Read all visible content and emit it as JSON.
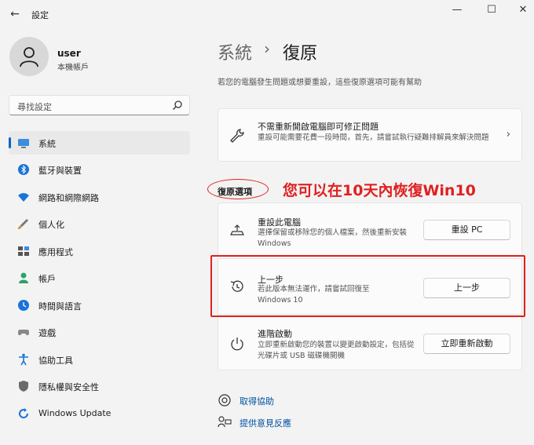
{
  "window": {
    "title": "設定",
    "back_glyph": "←",
    "minimize_glyph": "—",
    "maximize_glyph": "☐",
    "close_glyph": "✕"
  },
  "user": {
    "name": "user",
    "account_type": "本機帳戶"
  },
  "search": {
    "placeholder": "尋找設定"
  },
  "sidebar": {
    "items": [
      {
        "label": "系統",
        "icon": "monitor-icon",
        "active": true
      },
      {
        "label": "藍牙與裝置",
        "icon": "bluetooth-icon"
      },
      {
        "label": "網路和網際網路",
        "icon": "wifi-icon"
      },
      {
        "label": "個人化",
        "icon": "brush-icon"
      },
      {
        "label": "應用程式",
        "icon": "apps-icon"
      },
      {
        "label": "帳戶",
        "icon": "person-icon"
      },
      {
        "label": "時間與語言",
        "icon": "globe-clock-icon"
      },
      {
        "label": "遊戲",
        "icon": "gamepad-icon"
      },
      {
        "label": "協助工具",
        "icon": "accessibility-icon"
      },
      {
        "label": "隱私權與安全性",
        "icon": "shield-icon"
      },
      {
        "label": "Windows Update",
        "icon": "update-icon"
      }
    ]
  },
  "main": {
    "breadcrumb_parent": "系統",
    "breadcrumb_separator": "›",
    "breadcrumb_current": "復原",
    "subtitle": "若您的電腦發生問題或想要重設，這些復原選項可能有幫助",
    "fix_card": {
      "title": "不需重新開啟電腦即可修正問題",
      "desc": "重設可能需要花費一段時間，首先，請嘗試執行疑難排解員來解決問題",
      "chevron": "›",
      "icon": "wrench-icon"
    },
    "section_label": "復原選項",
    "annotation": "您可以在10天內恢復Win10",
    "options": [
      {
        "title": "重設此電腦",
        "desc": "選擇保留或移除您的個人檔案，然後重新安裝 Windows",
        "button": "重設 PC",
        "icon": "reset-pc-icon"
      },
      {
        "title": "上一步",
        "desc": "若此版本無法運作，請嘗試回復至 Windows 10",
        "button": "上一步",
        "icon": "history-icon"
      },
      {
        "title": "進階啟動",
        "desc": "立即重新啟動您的裝置以變更啟動設定，包括從光碟片或 USB 磁碟機開機",
        "button": "立即重新啟動",
        "icon": "advanced-startup-icon"
      }
    ],
    "links": [
      {
        "label": "取得協助",
        "icon": "help-icon"
      },
      {
        "label": "提供意見反應",
        "icon": "feedback-icon"
      }
    ]
  },
  "colors": {
    "accent": "#0067c0",
    "annotation_red": "#e02020"
  }
}
